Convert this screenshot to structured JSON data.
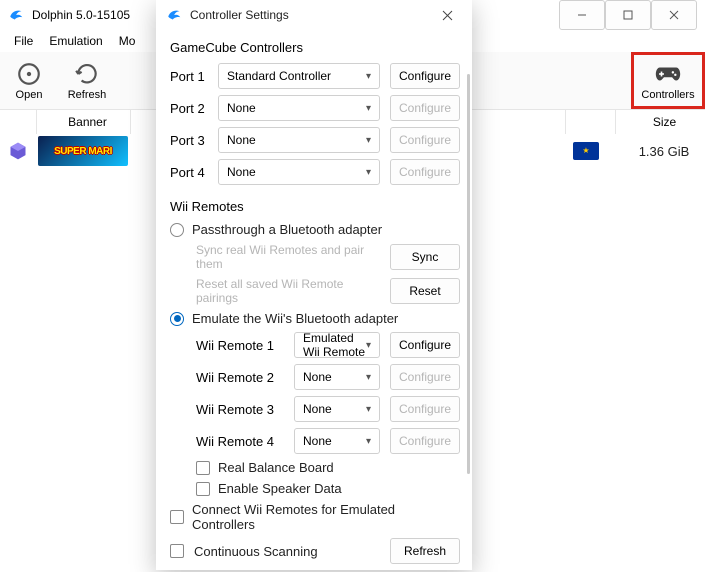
{
  "main": {
    "title": "Dolphin 5.0-15105",
    "menu": [
      "File",
      "Emulation",
      "Mo"
    ],
    "toolbar": {
      "open": "Open",
      "refresh": "Refresh",
      "controllers": "Controllers"
    },
    "list": {
      "headers": {
        "banner": "Banner",
        "size": "Size"
      },
      "row": {
        "banner_text": "SUPER MARI",
        "size": "1.36 GiB"
      }
    }
  },
  "dialog": {
    "title": "Controller Settings",
    "gc": {
      "section": "GameCube Controllers",
      "ports": [
        {
          "label": "Port 1",
          "value": "Standard Controller",
          "configure": "Configure",
          "enabled": true
        },
        {
          "label": "Port 2",
          "value": "None",
          "configure": "Configure",
          "enabled": false
        },
        {
          "label": "Port 3",
          "value": "None",
          "configure": "Configure",
          "enabled": false
        },
        {
          "label": "Port 4",
          "value": "None",
          "configure": "Configure",
          "enabled": false
        }
      ]
    },
    "wii": {
      "section": "Wii Remotes",
      "passthrough_label": "Passthrough a Bluetooth adapter",
      "sync_label": "Sync real Wii Remotes and pair them",
      "sync_btn": "Sync",
      "reset_label": "Reset all saved Wii Remote pairings",
      "reset_btn": "Reset",
      "emulate_label": "Emulate the Wii's Bluetooth adapter",
      "remotes": [
        {
          "label": "Wii Remote 1",
          "value": "Emulated Wii Remote",
          "configure": "Configure",
          "enabled": true
        },
        {
          "label": "Wii Remote 2",
          "value": "None",
          "configure": "Configure",
          "enabled": false
        },
        {
          "label": "Wii Remote 3",
          "value": "None",
          "configure": "Configure",
          "enabled": false
        },
        {
          "label": "Wii Remote 4",
          "value": "None",
          "configure": "Configure",
          "enabled": false
        }
      ],
      "balance_board": "Real Balance Board",
      "speaker": "Enable Speaker Data",
      "connect_emu": "Connect Wii Remotes for Emulated Controllers",
      "continuous": "Continuous Scanning",
      "refresh_btn": "Refresh"
    }
  }
}
